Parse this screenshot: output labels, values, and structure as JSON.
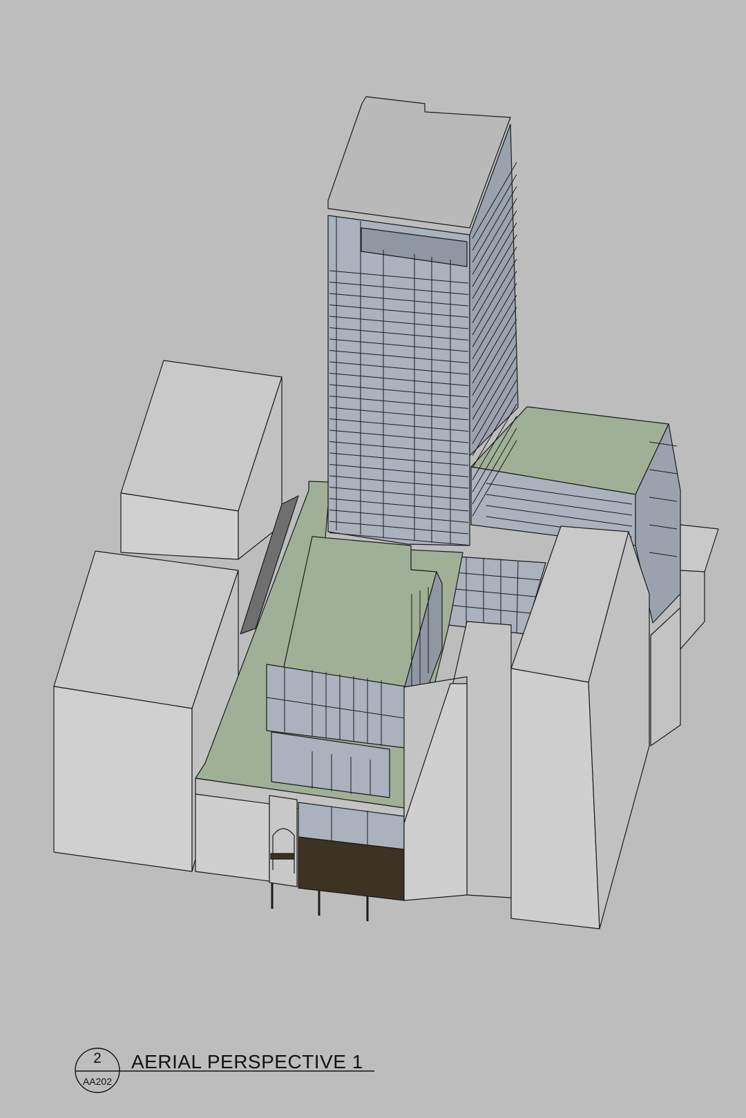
{
  "title_block": {
    "view_number": "2",
    "sheet_number": "AA202",
    "view_title": "AERIAL PERSPECTIVE 1"
  },
  "colors": {
    "background": "#bdbdbd",
    "massing_light": "#d0d0d0",
    "massing_mid": "#c3c3c3",
    "roof_tower": "#b9b9b9",
    "green_roof": "#9fb097",
    "glazing": "#a9b2bd",
    "entrance_canopy": "#3b3222",
    "shadow": "#6f6f6f"
  }
}
